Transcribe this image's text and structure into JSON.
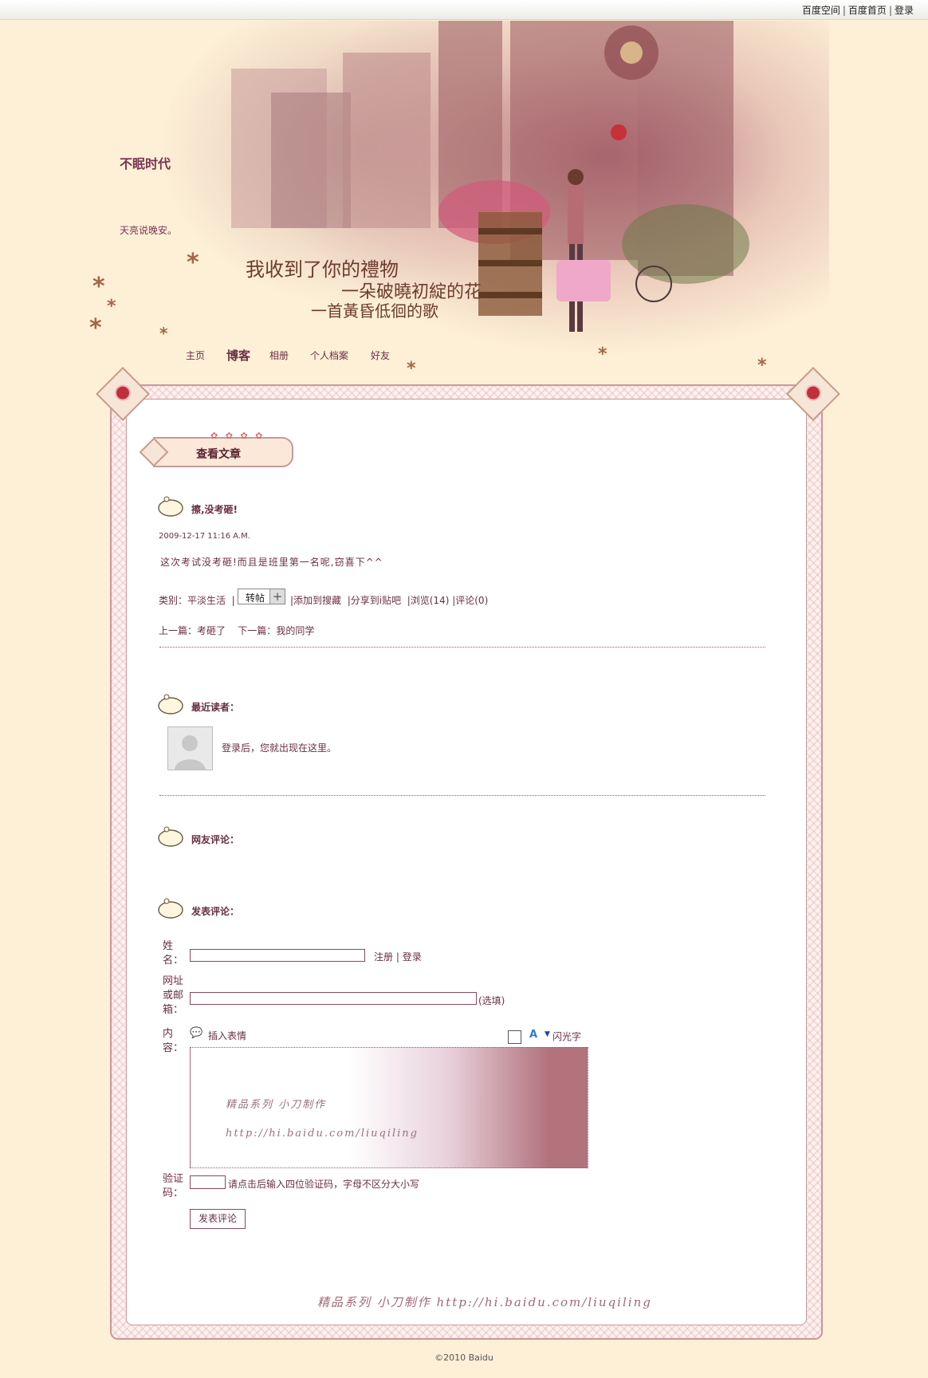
{
  "topbar": {
    "links": [
      "百度空间",
      "百度首页",
      "登录"
    ]
  },
  "header": {
    "blog_title": "不眠时代",
    "blog_desc": "天亮说晚安。",
    "poem_line1": "我收到了你的禮物",
    "poem_line2": "一朵破曉初綻的花",
    "poem_line3": "一首黃昏低徊的歌"
  },
  "nav": [
    "主页",
    "博客",
    "相册",
    "个人档案",
    "好友"
  ],
  "section_title": "查看文章",
  "article": {
    "title": "擦,没考砸!",
    "date": "2009-12-17 11:16 A.M.",
    "body": "这次考试没考砸!而且是班里第一名呢,窃喜下^^",
    "category_label": "类别：",
    "category": "平淡生活",
    "repost": "转帖",
    "add_fav": "添加到搜藏",
    "share": "分享到i贴吧",
    "views": "浏览(14)",
    "comments": "评论(0)",
    "prev_label": "上一篇：",
    "prev": "考砸了",
    "next_label": "下一篇：",
    "next": "我的同学"
  },
  "readers": {
    "heading": "最近读者：",
    "note": "登录后，您就出现在这里。"
  },
  "comments_heading": "网友评论：",
  "post": {
    "heading": "发表评论：",
    "name_label": "姓名：",
    "register": "注册",
    "login": "登录",
    "url_label": "网址或邮箱：",
    "optional": "(选填)",
    "content_label": "内容：",
    "insert_emoji": "插入表情",
    "flash_text": "闪光字",
    "ta_line1": "精品系列  小刀制作",
    "ta_line2": "http://hi.baidu.com/liuqiling",
    "captcha_label": "验证码：",
    "captcha_hint": "请点击后输入四位验证码，字母不区分大小写",
    "submit": "发表评论"
  },
  "footer_sig": "精品系列  小刀制作   http://hi.baidu.com/liuqiling",
  "copyright": "©2010 Baidu"
}
